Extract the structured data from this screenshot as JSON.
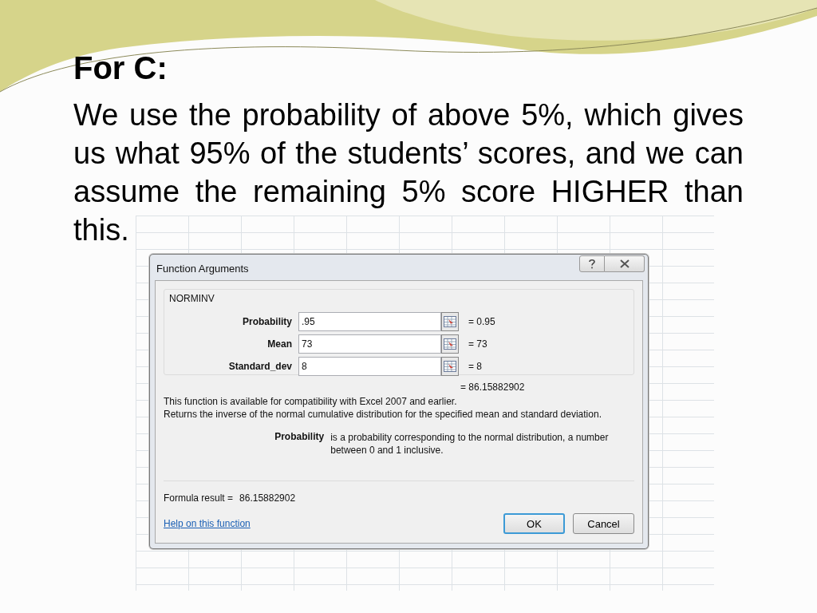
{
  "slide": {
    "title": "For C:",
    "paragraph": "We use the probability of above 5%, which gives us what 95% of the students’ scores, and we can assume the remaining 5% score HIGHER than this."
  },
  "dialog": {
    "title": "Function Arguments",
    "function_name": "NORMINV",
    "arguments": [
      {
        "label": "Probability",
        "value": ".95",
        "result": "= 0.95"
      },
      {
        "label": "Mean",
        "value": "73",
        "result": "= 73"
      },
      {
        "label": "Standard_dev",
        "value": "8",
        "result": "= 8"
      }
    ],
    "result": "= 86.15882902",
    "compat_note": "This function is available for compatibility with Excel 2007 and earlier.",
    "description": "Returns the inverse of the normal cumulative distribution for the specified mean and standard deviation.",
    "argument_help": {
      "name": "Probability",
      "text": "is a probability corresponding to the normal distribution, a number between 0 and 1 inclusive."
    },
    "formula_result_label": "Formula result =",
    "formula_result_value": "86.15882902",
    "help_link": "Help on this function",
    "buttons": [
      {
        "label": "OK",
        "default": true
      },
      {
        "label": "Cancel",
        "default": false
      }
    ]
  }
}
